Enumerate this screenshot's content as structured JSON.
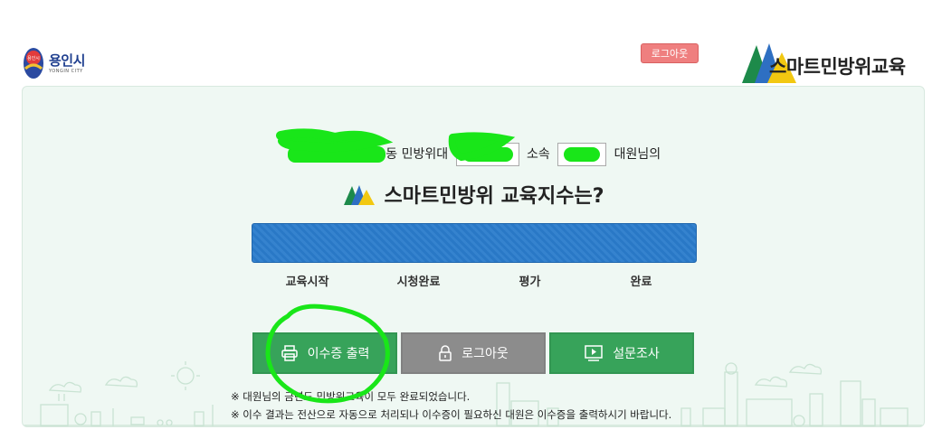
{
  "header": {
    "city_name": "용인시",
    "city_sub": "YONGIN CITY",
    "logout_label": "로그아웃",
    "brand_title": "스마트민방위교육"
  },
  "greeting": {
    "part1": "동 민방위대",
    "part2": "소속",
    "part3": "대원님의"
  },
  "index_title": "스마트민방위 교육지수는?",
  "progress": {
    "value_percent": 100,
    "color": "#2a7ccc"
  },
  "steps": [
    "교육시작",
    "시청완료",
    "평가",
    "완료"
  ],
  "actions": {
    "certificate_label": "이수증 출력",
    "logout_label": "로그아웃",
    "survey_label": "설문조사"
  },
  "notes": [
    "※ 대원님의 금년도 민방위교육이 모두 완료되었습니다.",
    "※ 이수 결과는 전산으로 자동으로 처리되나 이수증이 필요하신 대원은 이수증을 출력하시기 바랍니다."
  ],
  "colors": {
    "accent_green": "#37a35a",
    "logout_pink": "#ef7f7f",
    "panel_bg": "#eff8f3",
    "annotation_green": "#19e619"
  },
  "icons": [
    "printer-icon",
    "lock-icon",
    "monitor-play-icon"
  ]
}
